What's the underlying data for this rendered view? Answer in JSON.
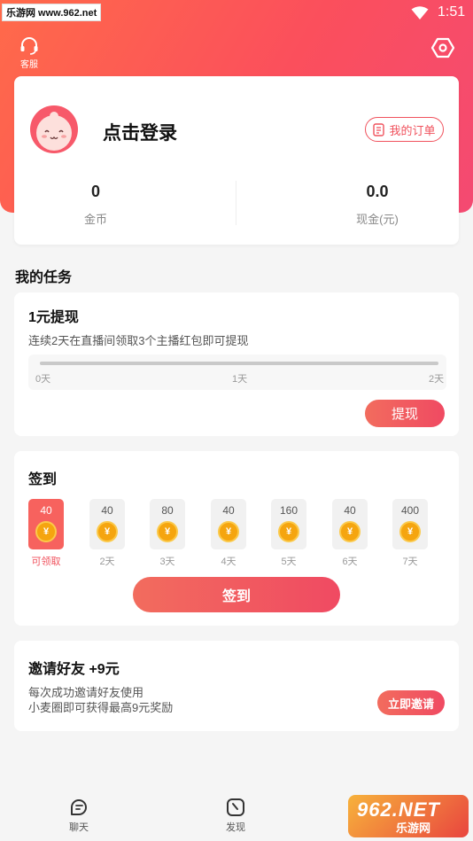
{
  "status_bar": {
    "watermark": "乐游网 www.962.net",
    "time": "1:51"
  },
  "header": {
    "customer_service_label": "客服"
  },
  "profile": {
    "login_text": "点击登录",
    "orders_label": "我的订单",
    "coins_value": "0",
    "coins_label": "金币",
    "cash_value": "0.0",
    "cash_label": "现金(元)"
  },
  "tasks_section_title": "我的任务",
  "withdraw_task": {
    "title": "1元提现",
    "description": "连续2天在直播间领取3个主播红包即可提现",
    "progress": 0,
    "ticks": [
      "0天",
      "1天",
      "2天"
    ],
    "button": "提现"
  },
  "signin": {
    "title": "签到",
    "days": [
      {
        "amount": "40",
        "label": "可领取",
        "active": true
      },
      {
        "amount": "40",
        "label": "2天",
        "active": false
      },
      {
        "amount": "80",
        "label": "3天",
        "active": false
      },
      {
        "amount": "40",
        "label": "4天",
        "active": false
      },
      {
        "amount": "160",
        "label": "5天",
        "active": false
      },
      {
        "amount": "40",
        "label": "6天",
        "active": false
      },
      {
        "amount": "400",
        "label": "7天",
        "active": false
      }
    ],
    "coin_symbol": "¥",
    "button": "签到"
  },
  "invite": {
    "title": "邀请好友 +9元",
    "description_line1": "每次成功邀请好友使用",
    "description_line2": "小麦圈即可获得最高9元奖励",
    "button": "立即邀请"
  },
  "bottom_nav": [
    {
      "label": "聊天",
      "icon": "chat-icon"
    },
    {
      "label": "发现",
      "icon": "discover-icon"
    }
  ],
  "watermark_br": {
    "big": "962.NET",
    "small": "乐游网"
  },
  "colors": {
    "accent": "#f0525d",
    "header_start": "#ff6a4a",
    "header_end": "#f44a72",
    "coin": "#f5a50f"
  }
}
